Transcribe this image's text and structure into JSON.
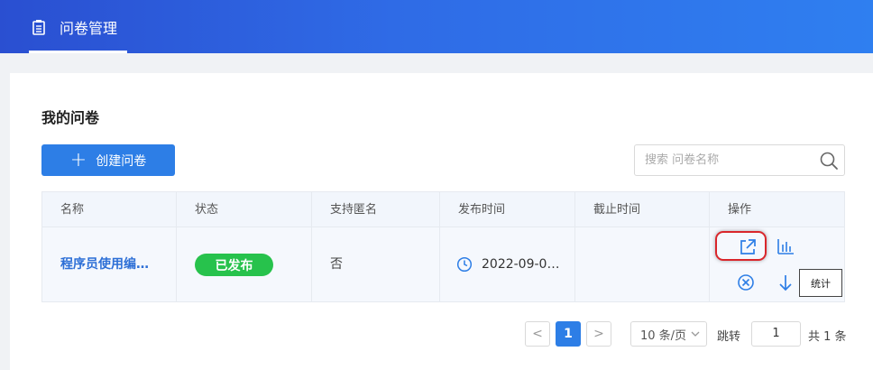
{
  "header": {
    "nav_label": "问卷管理",
    "brand_color": "#2f6be6"
  },
  "main": {
    "section_title": "我的问卷",
    "create_button_label": "创建问卷",
    "search_placeholder": "搜索 问卷名称"
  },
  "table": {
    "columns": [
      "名称",
      "状态",
      "支持匿名",
      "发布时间",
      "截止时间",
      "操作"
    ],
    "rows": [
      {
        "name": "程序员使用编…",
        "status": "已发布",
        "anonymous": "否",
        "publish_time": "2022-09-0…",
        "deadline": ""
      }
    ],
    "action_icons": [
      "open-external-icon",
      "bar-chart-icon",
      "close-circle-icon",
      "arrow-down-icon"
    ],
    "tooltip": "统计"
  },
  "pagination": {
    "prev": "<",
    "current_page": "1",
    "next": ">",
    "page_size": "10 条/页",
    "jump_label": "跳转",
    "jump_value": "1",
    "total": "共 1 条"
  }
}
